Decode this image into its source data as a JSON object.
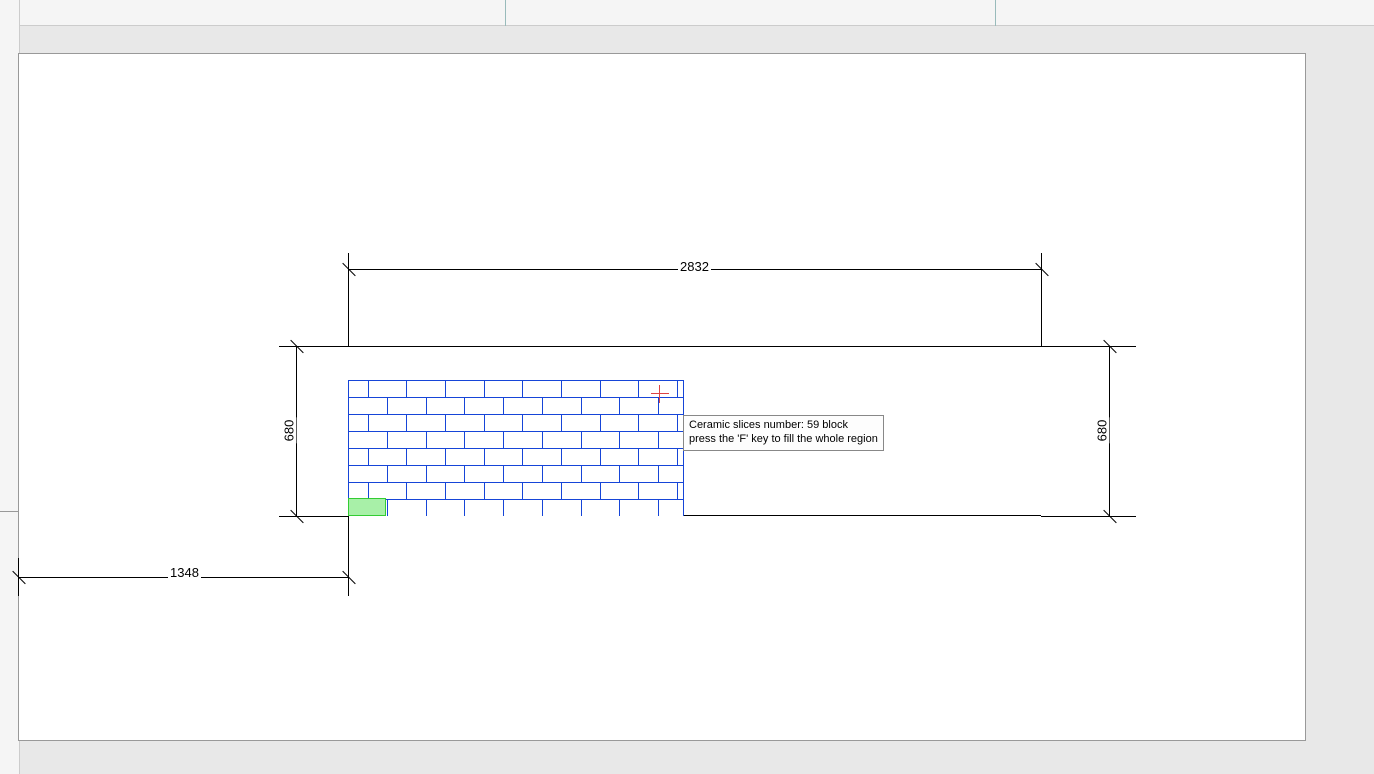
{
  "dimensions": {
    "top_width": "2832",
    "left_height": "680",
    "right_height": "680",
    "bottom_left": "1348"
  },
  "tooltip": {
    "line1": "Ceramic slices number: 59 block",
    "line2": "press the 'F' key to fill the whole region"
  },
  "brick": {
    "rows": 8,
    "cols_full": 8,
    "offset_pattern": "running-bond"
  }
}
